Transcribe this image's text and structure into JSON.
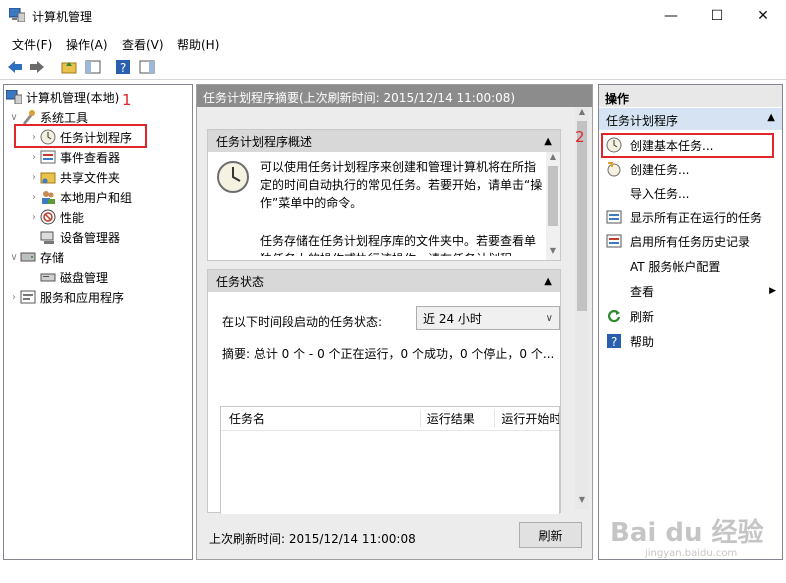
{
  "window": {
    "title": "计算机管理"
  },
  "menu": [
    "文件(F)",
    "操作(A)",
    "查看(V)",
    "帮助(H)"
  ],
  "tree": {
    "root": "计算机管理(本地)",
    "system_tools": "系统工具",
    "task_scheduler": "任务计划程序",
    "event_viewer": "事件查看器",
    "shared_folders": "共享文件夹",
    "local_users": "本地用户和组",
    "performance": "性能",
    "device_manager": "设备管理器",
    "storage": "存储",
    "disk_management": "磁盘管理",
    "services_apps": "服务和应用程序"
  },
  "center": {
    "header": "任务计划程序摘要(上次刷新时间: 2015/12/14 11:00:08)",
    "overview_title": "任务计划程序概述",
    "overview_p1": "可以使用任务计划程序来创建和管理计算机将在所指定的时间自动执行的常见任务。若要开始，请单击“操作”菜单中的命令。",
    "overview_p2": "任务存储在任务计划程序库的文件夹中。若要查看单独任务上的操作或执行该操作，请在任务计划程",
    "status_title": "任务状态",
    "status_label": "在以下时间段启动的任务状态:",
    "status_select": "近 24 小时",
    "summary": "摘要: 总计 0 个 - 0 个正在运行，0 个成功，0 个停止，0 个...",
    "columns": [
      "任务名",
      "运行结果",
      "运行开始时"
    ],
    "last_refresh": "上次刷新时间: 2015/12/14 11:00:08",
    "refresh_btn": "刷新"
  },
  "actions": {
    "header": "操作",
    "group": "任务计划程序",
    "items": [
      "创建基本任务...",
      "创建任务...",
      "导入任务...",
      "显示所有正在运行的任务",
      "启用所有任务历史记录",
      "AT 服务帐户配置",
      "查看",
      "刷新",
      "帮助"
    ]
  },
  "annotations": {
    "one": "1",
    "two": "2"
  },
  "watermark": {
    "brand": "Bai du 经验",
    "url": "jingyan.baidu.com"
  }
}
